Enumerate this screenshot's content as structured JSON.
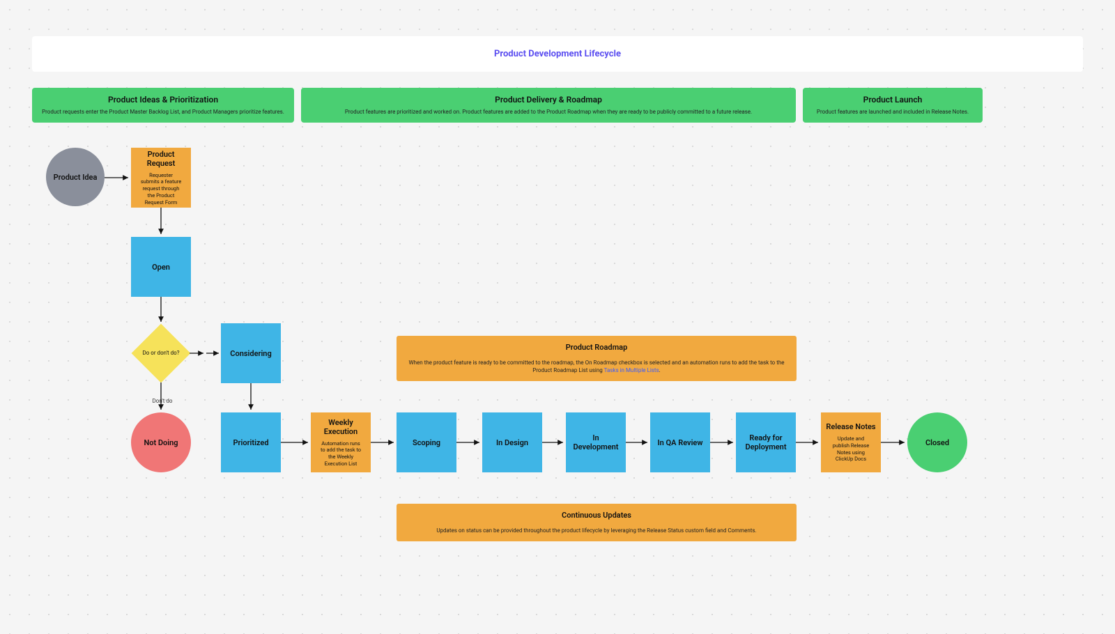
{
  "title": "Product Development Lifecycle",
  "phases": {
    "ideas": {
      "title": "Product Ideas & Prioritization",
      "desc": "Product requests enter the Product Master Backlog List, and Product Managers prioritize features."
    },
    "delivery": {
      "title": "Product Delivery & Roadmap",
      "desc": "Product features are prioritized and worked on. Product features are added to the Product Roadmap when they are ready to be publicly committed to a future release."
    },
    "launch": {
      "title": "Product Launch",
      "desc": "Product features are launched and included in Release Notes."
    }
  },
  "nodes": {
    "product_idea": "Product Idea",
    "product_request": {
      "title": "Product Request",
      "desc": "Requester submits a feature request through the Product Request Form"
    },
    "open": "Open",
    "decision": "Do or don't do?",
    "decision_no_label": "Don't do",
    "considering": "Considering",
    "not_doing": "Not Doing",
    "prioritized": "Prioritized",
    "weekly": {
      "title": "Weekly Execution",
      "desc": "Automation runs to add the task to the Weekly Execution List"
    },
    "scoping": "Scoping",
    "in_design": "In Design",
    "in_development": "In Development",
    "in_qa": "In QA Review",
    "ready": "Ready for Deployment",
    "release_notes": {
      "title": "Release Notes",
      "desc": "Update and publish Release Notes using ClickUp Docs"
    },
    "closed": "Closed"
  },
  "roadmap": {
    "title": "Product Roadmap",
    "desc": "When the product feature is ready to be committed to the roadmap, the On Roadmap checkbox is selected and an automation runs to add the task to the Product Roadmap List using ",
    "link": "Tasks in Multiple Lists"
  },
  "continuous": {
    "title": "Continuous Updates",
    "desc": "Updates on status can be provided throughout the product lifecycle by leveraging the Release Status custom field and Comments."
  }
}
